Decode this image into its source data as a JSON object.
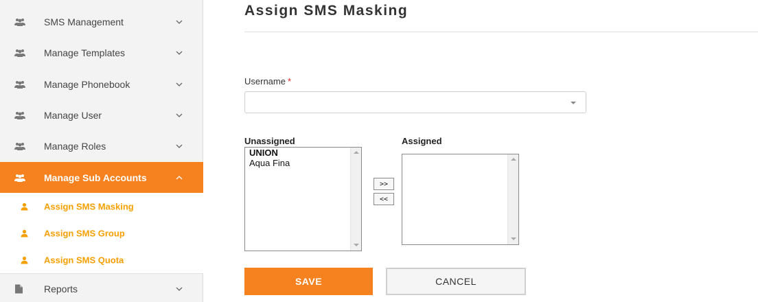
{
  "colors": {
    "accent": "#f5821f",
    "submenu_text": "#f5a000",
    "required": "#e02020"
  },
  "sidebar": {
    "items": [
      {
        "label": "SMS Management",
        "icon": "users-icon",
        "chevron": "chevron-down-icon"
      },
      {
        "label": "Manage Templates",
        "icon": "users-icon",
        "chevron": "chevron-down-icon"
      },
      {
        "label": "Manage Phonebook",
        "icon": "users-icon",
        "chevron": "chevron-down-icon"
      },
      {
        "label": "Manage User",
        "icon": "users-icon",
        "chevron": "chevron-down-icon"
      },
      {
        "label": "Manage Roles",
        "icon": "users-icon",
        "chevron": "chevron-down-icon"
      },
      {
        "label": "Manage Sub Accounts",
        "icon": "users-icon",
        "chevron": "chevron-up-icon",
        "active": true
      },
      {
        "label": "Reports",
        "icon": "file-icon",
        "chevron": "chevron-down-icon"
      }
    ],
    "sub_items": [
      {
        "label": "Assign SMS Masking",
        "icon": "user-icon"
      },
      {
        "label": "Assign SMS Group",
        "icon": "user-icon"
      },
      {
        "label": "Assign SMS Quota",
        "icon": "user-icon"
      }
    ]
  },
  "main": {
    "title": "Assign SMS Masking",
    "username": {
      "label": "Username",
      "required_mark": "*",
      "value": ""
    },
    "unassigned": {
      "label": "Unassigned",
      "options": [
        "UNION",
        "Aqua Fina"
      ]
    },
    "assigned": {
      "label": "Assigned",
      "options": []
    },
    "move_right_label": ">>",
    "move_left_label": "<<",
    "save_label": "SAVE",
    "cancel_label": "CANCEL"
  }
}
